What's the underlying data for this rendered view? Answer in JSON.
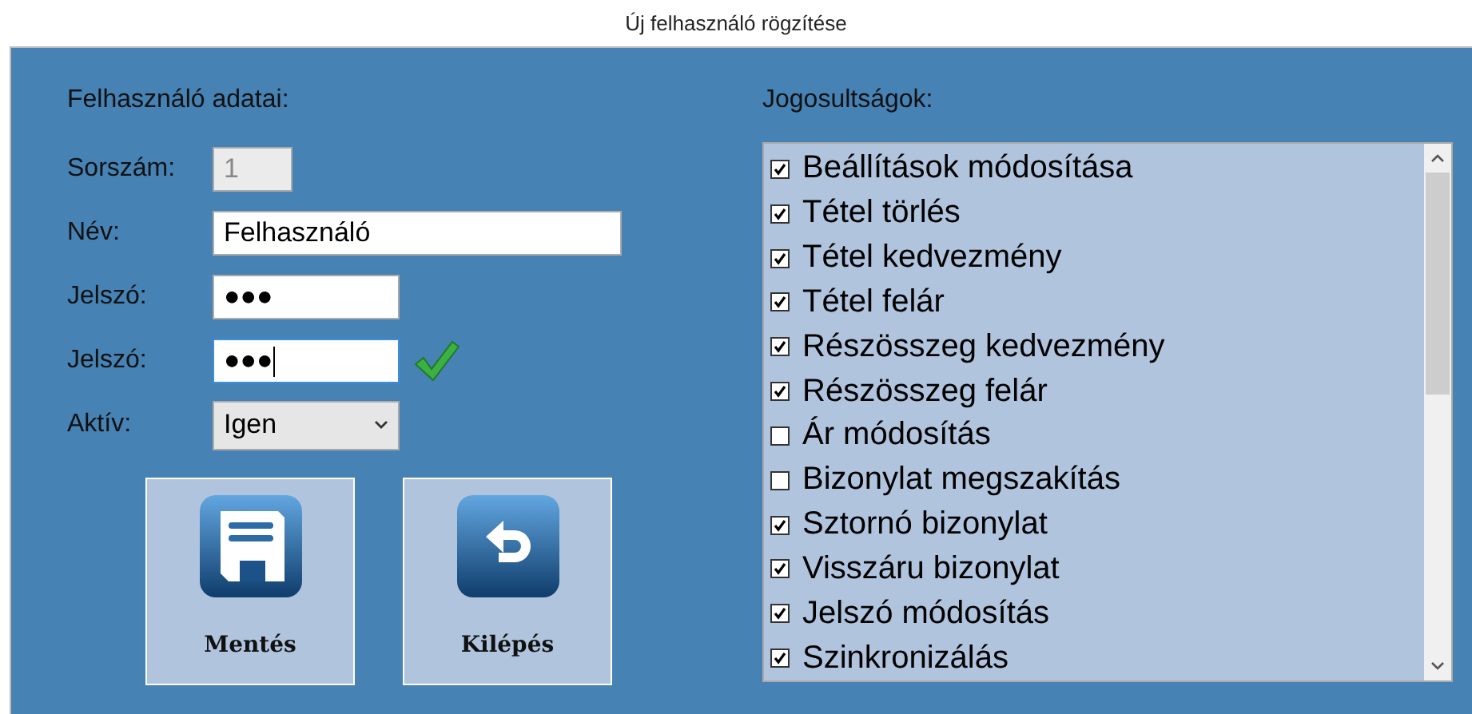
{
  "window": {
    "title": "Új felhasználó rögzítése"
  },
  "user_section": {
    "heading": "Felhasználó adatai:",
    "fields": [
      {
        "kind": "text",
        "label": "Sorszám:",
        "value": "1",
        "disabled": true,
        "focused": false,
        "valid": false
      },
      {
        "kind": "text",
        "label": "Név:",
        "value": "Felhasználó",
        "disabled": false,
        "focused": false,
        "valid": false
      },
      {
        "kind": "text",
        "label": "Jelszó:",
        "value": "●●●",
        "disabled": false,
        "focused": false,
        "valid": false
      },
      {
        "kind": "text",
        "label": "Jelszó:",
        "value": "●●●",
        "disabled": false,
        "focused": true,
        "valid": true
      },
      {
        "kind": "select",
        "label": "Aktív:",
        "value": "Igen",
        "disabled": false,
        "focused": false,
        "valid": false
      }
    ]
  },
  "buttons": [
    {
      "label": "Mentés"
    },
    {
      "label": "Kilépés"
    }
  ],
  "permissions": {
    "heading": "Jogosultságok:",
    "items": [
      {
        "label": "Beállítások módosítása",
        "checked": true
      },
      {
        "label": "Tétel törlés",
        "checked": true
      },
      {
        "label": "Tétel kedvezmény",
        "checked": true
      },
      {
        "label": "Tétel felár",
        "checked": true
      },
      {
        "label": "Részösszeg kedvezmény",
        "checked": true
      },
      {
        "label": "Részösszeg felár",
        "checked": true
      },
      {
        "label": "Ár módosítás",
        "checked": false
      },
      {
        "label": "Bizonylat megszakítás",
        "checked": false
      },
      {
        "label": "Sztornó bizonylat",
        "checked": true
      },
      {
        "label": "Visszáru bizonylat",
        "checked": true
      },
      {
        "label": "Jelszó módosítás",
        "checked": true
      },
      {
        "label": "Szinkronizálás",
        "checked": true
      }
    ]
  }
}
